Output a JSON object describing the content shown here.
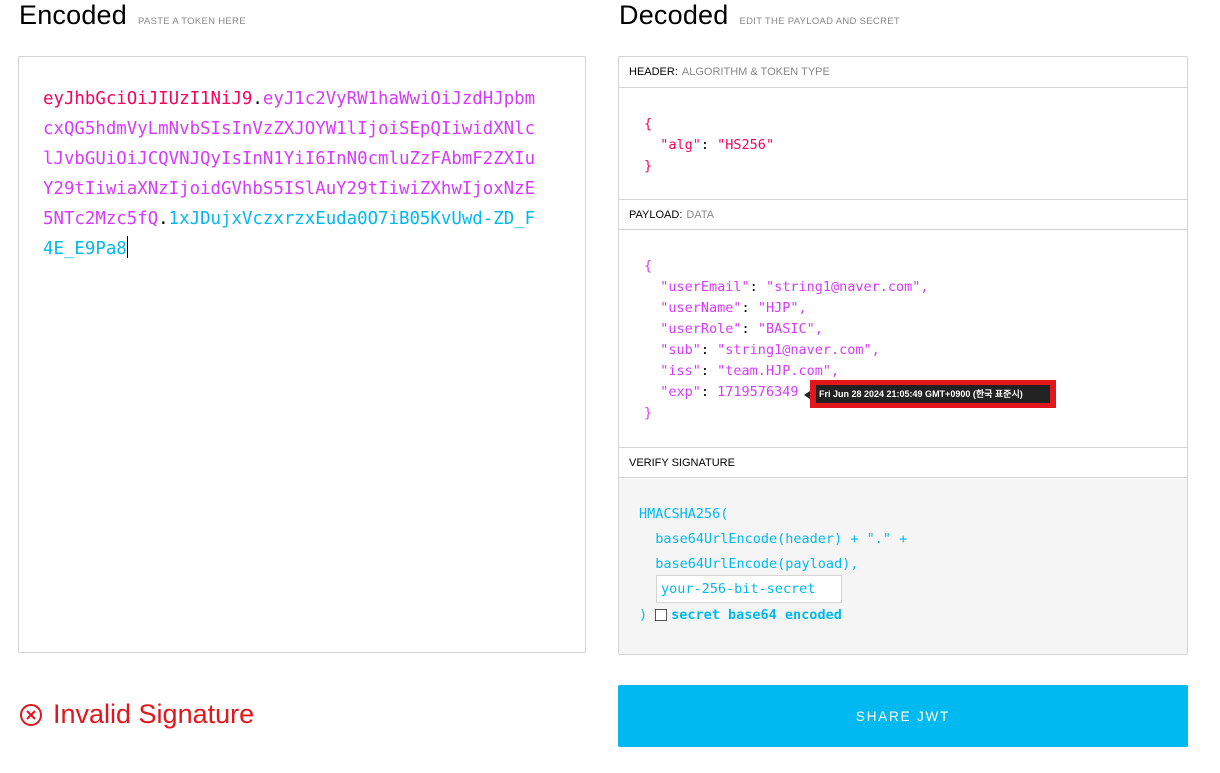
{
  "encoded": {
    "title": "Encoded",
    "subtitle": "PASTE A TOKEN HERE",
    "token_header": "eyJhbGciOiJIUzI1NiJ9",
    "token_payload": "eyJ1c2VyRW1haWwiOiJzdHJpbmcxQG5hdmVyLmNvbSIsInVzZXJOYW1lIjoiSEpQIiwidXNlclJvbGUiOiJCQVNJQyIsInN1YiI6InN0cmluZzFAbmF2ZXIuY29tIiwiaXNzIjoidGVhbS5ISlAuY29tIiwiZXhwIjoxNzE5NTc2Mzc5fQ",
    "token_signature": "1xJDujxVczxrzxEuda0O7iB05KvUwd-ZD_F4E_E9Pa8",
    "dot": "."
  },
  "decoded": {
    "title": "Decoded",
    "subtitle": "EDIT THE PAYLOAD AND SECRET",
    "header_label": "HEADER:",
    "header_sub": "ALGORITHM & TOKEN TYPE",
    "payload_label": "PAYLOAD:",
    "payload_sub": "DATA",
    "verify_label": "VERIFY SIGNATURE"
  },
  "header_json": {
    "open": "{",
    "close": "}",
    "alg_key": "\"alg\"",
    "alg_val": "\"HS256\""
  },
  "payload_json": {
    "open": "{",
    "close": "}",
    "rows": [
      {
        "key": "\"userEmail\"",
        "val": "\"string1@naver.com\","
      },
      {
        "key": "\"userName\"",
        "val": "\"HJP\","
      },
      {
        "key": "\"userRole\"",
        "val": "\"BASIC\","
      },
      {
        "key": "\"sub\"",
        "val": "\"string1@naver.com\","
      },
      {
        "key": "\"iss\"",
        "val": "\"team.HJP.com\","
      },
      {
        "key": "\"exp\"",
        "val": "1719576349"
      }
    ],
    "tooltip": "Fri Jun 28 2024 21:05:49 GMT+0900 (한국 표준시)"
  },
  "verify": {
    "line1": "HMACSHA256(",
    "line2": "  base64UrlEncode(header) + \".\" +",
    "line3": "  base64UrlEncode(payload),",
    "secret_placeholder": "your-256-bit-secret",
    "close_paren": ")",
    "checkbox_label": "secret base64 encoded"
  },
  "status": {
    "text": "Invalid Signature",
    "color": "#e2161b"
  },
  "share_button": "SHARE JWT",
  "colors": {
    "header": "#fb015b",
    "payload": "#d63aff",
    "signature": "#00b9f1"
  }
}
